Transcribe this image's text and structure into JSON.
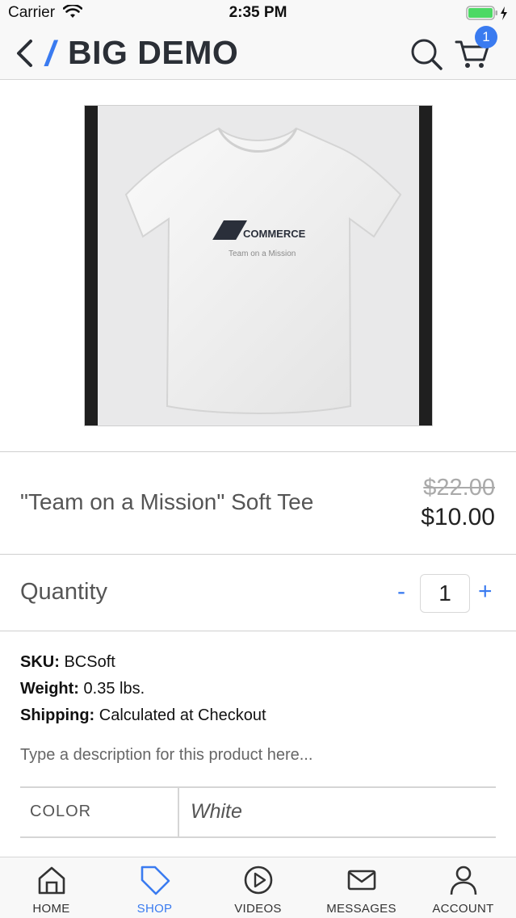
{
  "status_bar": {
    "carrier": "Carrier",
    "time": "2:35 PM"
  },
  "nav": {
    "brand": "BIG DEMO",
    "cart_count": "1"
  },
  "product": {
    "image_text": {
      "logo": "COMMERCE",
      "tagline": "Team on a Mission"
    },
    "name": "\"Team on a Mission\" Soft Tee",
    "old_price": "$22.00",
    "price": "$10.00"
  },
  "quantity": {
    "label": "Quantity",
    "minus": "-",
    "value": "1",
    "plus": "+"
  },
  "specs": {
    "sku_label": "SKU:",
    "sku_value": "BCSoft",
    "weight_label": "Weight:",
    "weight_value": "0.35 lbs.",
    "shipping_label": "Shipping:",
    "shipping_value": "Calculated at Checkout"
  },
  "description": "Type a description for this product here...",
  "option": {
    "name": "COLOR",
    "value": "White"
  },
  "tabs": [
    {
      "label": "HOME",
      "icon": "home-icon"
    },
    {
      "label": "SHOP",
      "icon": "tag-icon"
    },
    {
      "label": "VIDEOS",
      "icon": "play-icon"
    },
    {
      "label": "MESSAGES",
      "icon": "mail-icon"
    },
    {
      "label": "ACCOUNT",
      "icon": "user-icon"
    }
  ],
  "colors": {
    "accent": "#3a7bf0",
    "brand_text": "#2b2f36"
  }
}
